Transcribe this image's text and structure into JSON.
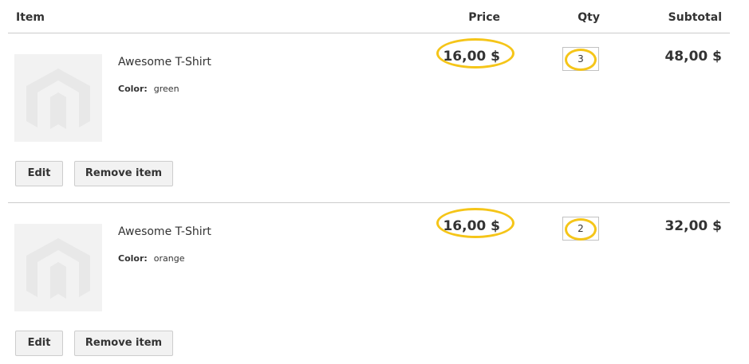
{
  "header": {
    "item": "Item",
    "price": "Price",
    "qty": "Qty",
    "subtotal": "Subtotal"
  },
  "items": [
    {
      "name": "Awesome T-Shirt",
      "option_label": "Color:",
      "option_value": "green",
      "price": "16,00 $",
      "qty": "3",
      "subtotal": "48,00 $",
      "edit_label": "Edit",
      "remove_label": "Remove item"
    },
    {
      "name": "Awesome T-Shirt",
      "option_label": "Color:",
      "option_value": "orange",
      "price": "16,00 $",
      "qty": "2",
      "subtotal": "32,00 $",
      "edit_label": "Edit",
      "remove_label": "Remove item"
    }
  ],
  "colors": {
    "highlight": "#f5c518",
    "divider": "#cccccc",
    "button_bg": "#f2f2f2",
    "placeholder_bg": "#f2f2f2"
  },
  "icons": {
    "placeholder": "magento-logo-placeholder-icon"
  }
}
